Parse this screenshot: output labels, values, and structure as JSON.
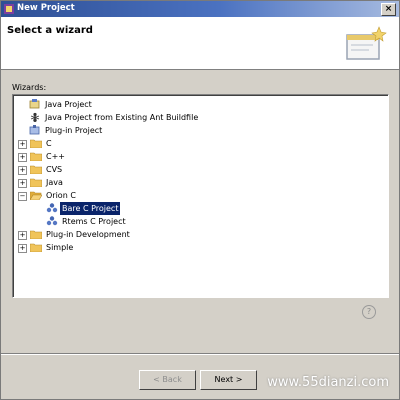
{
  "window": {
    "title": "New Project"
  },
  "header": {
    "title": "Select a wizard"
  },
  "wizards": {
    "label": "Wizards:",
    "items": [
      {
        "label": "Java Project",
        "icon": "java-project-icon"
      },
      {
        "label": "Java Project from Existing Ant Buildfile",
        "icon": "ant-icon"
      },
      {
        "label": "Plug-in Project",
        "icon": "plugin-icon"
      },
      {
        "label": "C",
        "icon": "folder-icon",
        "expanded": false
      },
      {
        "label": "C++",
        "icon": "folder-icon",
        "expanded": false
      },
      {
        "label": "CVS",
        "icon": "folder-icon",
        "expanded": false
      },
      {
        "label": "Java",
        "icon": "folder-icon",
        "expanded": false
      },
      {
        "label": "Orion C",
        "icon": "folder-icon",
        "expanded": true
      },
      {
        "label": "Bare C Project",
        "icon": "project-icon",
        "selected": true
      },
      {
        "label": "Rtems C Project",
        "icon": "project-icon"
      },
      {
        "label": "Plug-in Development",
        "icon": "folder-icon",
        "expanded": false
      },
      {
        "label": "Simple",
        "icon": "folder-icon",
        "expanded": false
      }
    ]
  },
  "buttons": {
    "back": "< Back",
    "next": "Next >"
  },
  "watermark": "www.55dianzi.com",
  "colors": {
    "title_bar": "#2e4f95",
    "selection": "#0a246a",
    "folder": "#f0c45a"
  }
}
